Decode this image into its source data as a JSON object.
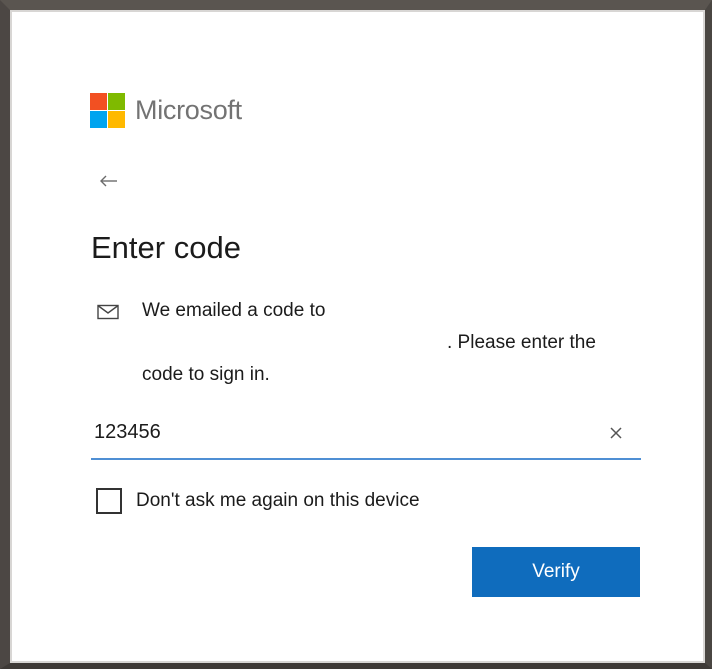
{
  "brand": {
    "name": "Microsoft",
    "logo_colors": [
      "#f25022",
      "#7fba00",
      "#00a4ef",
      "#ffb900"
    ],
    "icon": "microsoft-logo-icon"
  },
  "nav": {
    "back_icon": "back-arrow-icon"
  },
  "page": {
    "title": "Enter code"
  },
  "message": {
    "icon": "mail-icon",
    "line1": "We emailed a code to",
    "line2": ". Please enter the",
    "line3": "code to sign in."
  },
  "code_field": {
    "value": "123456",
    "clear_icon": "close-icon",
    "accent_color": "#4f8fd4"
  },
  "remember": {
    "label": "Don't ask me again on this device",
    "checked": false
  },
  "actions": {
    "verify_label": "Verify",
    "verify_color": "#0f6cbd"
  }
}
